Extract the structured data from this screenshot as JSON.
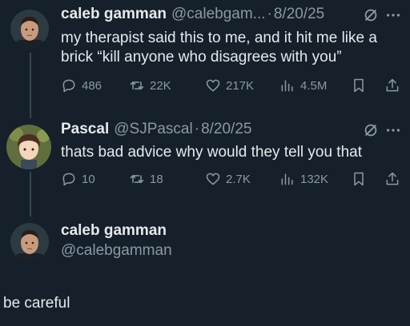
{
  "tweet1": {
    "name": "caleb gamman",
    "handle": "@calebgam...",
    "date": "8/20/25",
    "text_line1": "my therapist said this to me, and it hit me like a",
    "text_line2": "brick “kill anyone who disagrees with you”",
    "replies": "486",
    "retweets": "22K",
    "likes": "217K",
    "views": "4.5M"
  },
  "tweet2": {
    "name": "Pascal",
    "handle": "@SJPascal",
    "date": "8/20/25",
    "text": "thats bad advice why would they tell you that",
    "replies": "10",
    "retweets": "18",
    "likes": "2.7K",
    "views": "132K"
  },
  "reply_user": {
    "name": "caleb gamman",
    "handle": "@calebgamman"
  },
  "reply_text": "be careful",
  "separator": "·",
  "icons": [
    "avatar",
    "grok-icon",
    "more-icon",
    "reply-icon",
    "retweet-icon",
    "like-icon",
    "views-icon",
    "bookmark-icon",
    "share-icon"
  ],
  "colors": {
    "background": "#15202b",
    "text": "#e7e9ea",
    "muted": "#8b98a5",
    "thread_line": "#38444d"
  }
}
